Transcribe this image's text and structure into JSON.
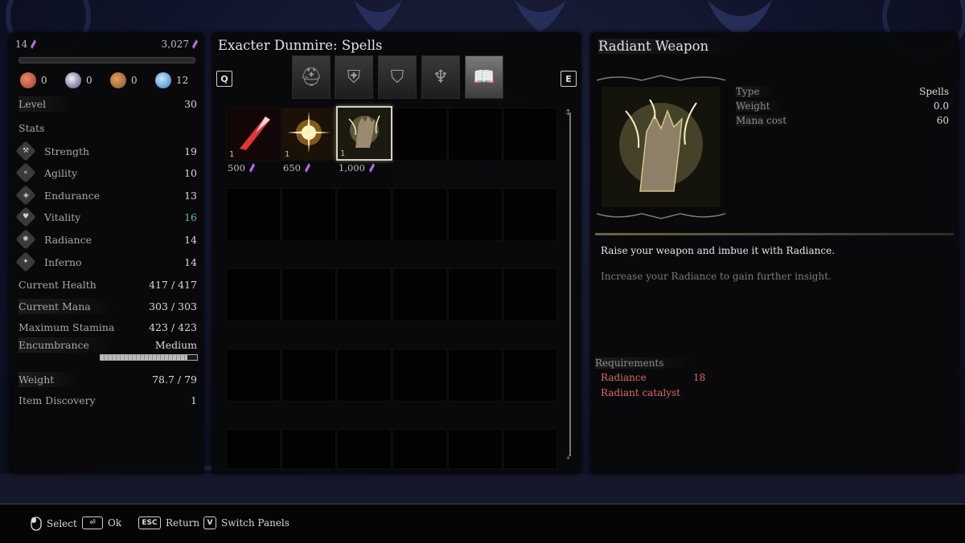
{
  "left": {
    "shards_left": "14",
    "shards_right": "3,027",
    "resources": [
      {
        "icon": "red-glove-icon",
        "value": "0"
      },
      {
        "icon": "orb-icon",
        "value": "0"
      },
      {
        "icon": "bronze-icon",
        "value": "0"
      },
      {
        "icon": "blue-crystal-icon",
        "value": "12"
      }
    ],
    "level_label": "Level",
    "level_value": "30",
    "stats_heading": "Stats",
    "stats": [
      {
        "label": "Strength",
        "value": "19"
      },
      {
        "label": "Agility",
        "value": "10"
      },
      {
        "label": "Endurance",
        "value": "13"
      },
      {
        "label": "Vitality",
        "value": "16"
      },
      {
        "label": "Radiance",
        "value": "14"
      },
      {
        "label": "Inferno",
        "value": "14"
      }
    ],
    "current_health_label": "Current Health",
    "current_health_value": "417 / 417",
    "current_mana_label": "Current Mana",
    "current_mana_value": "303 / 303",
    "max_stamina_label": "Maximum Stamina",
    "max_stamina_value": "423 / 423",
    "encumbrance_label": "Encumbrance",
    "encumbrance_value": "Medium",
    "encumbrance_fill": 0.9,
    "weight_label": "Weight",
    "weight_value": "78.7 / 79",
    "item_discovery_label": "Item Discovery",
    "item_discovery_value": "1"
  },
  "mid": {
    "title": "Exacter Dunmire: Spells",
    "key_left": "Q",
    "key_right": "E",
    "items": [
      {
        "qty": "1",
        "price": "500"
      },
      {
        "qty": "1",
        "price": "650"
      },
      {
        "qty": "1",
        "price": "1,000"
      }
    ]
  },
  "right": {
    "title": "Radiant Weapon",
    "type_label": "Type",
    "type_value": "Spells",
    "weight_label": "Weight",
    "weight_value": "0.0",
    "mana_label": "Mana cost",
    "mana_value": "60",
    "description": "Raise your weapon and imbue it with Radiance.",
    "hint": "Increase your Radiance to gain further insight.",
    "requirements_title": "Requirements",
    "req_radiance_label": "Radiance",
    "req_radiance_value": "18",
    "req_catalyst": "Radiant catalyst"
  },
  "bottom": {
    "select_label": "Select",
    "ok_label": "Ok",
    "return_key": "ESC",
    "return_label": "Return",
    "switch_key": "V",
    "switch_label": "Switch Panels"
  },
  "colors": {
    "accent_gold": "#d9d2bd",
    "requirement_red": "#d96a6a",
    "vitality_green": "#6fb89b",
    "shard_purple": "#b36be0"
  }
}
